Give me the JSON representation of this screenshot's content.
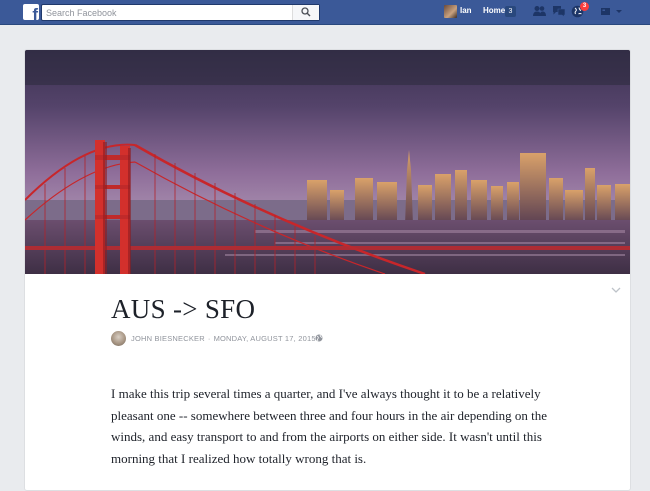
{
  "topbar": {
    "logo_letter": "f",
    "search_placeholder": "Search Facebook",
    "user_name": "Ian",
    "home_label": "Home",
    "home_count": "3",
    "notification_count": "3",
    "bar_color": "#3b5998"
  },
  "post": {
    "title": "AUS -> SFO",
    "author": "JOHN BIESNECKER",
    "separator": "·",
    "date": "MONDAY, AUGUST 17, 2015",
    "body": "I make this trip several times a quarter, and I've always thought it to be a relatively pleasant one -- somewhere between three and four hours in the air depending on the winds, and easy transport to and from the airports on either side. It wasn't until this morning that I realized how totally wrong that is."
  },
  "icons": {
    "logo": "facebook-logo",
    "search": "search-icon",
    "friends": "friend-requests-icon",
    "messages": "messages-icon",
    "notifications": "notifications-globe-icon",
    "settings": "settings-menu-icon",
    "chevron": "chevron-down-icon",
    "privacy": "public-globe-icon"
  }
}
